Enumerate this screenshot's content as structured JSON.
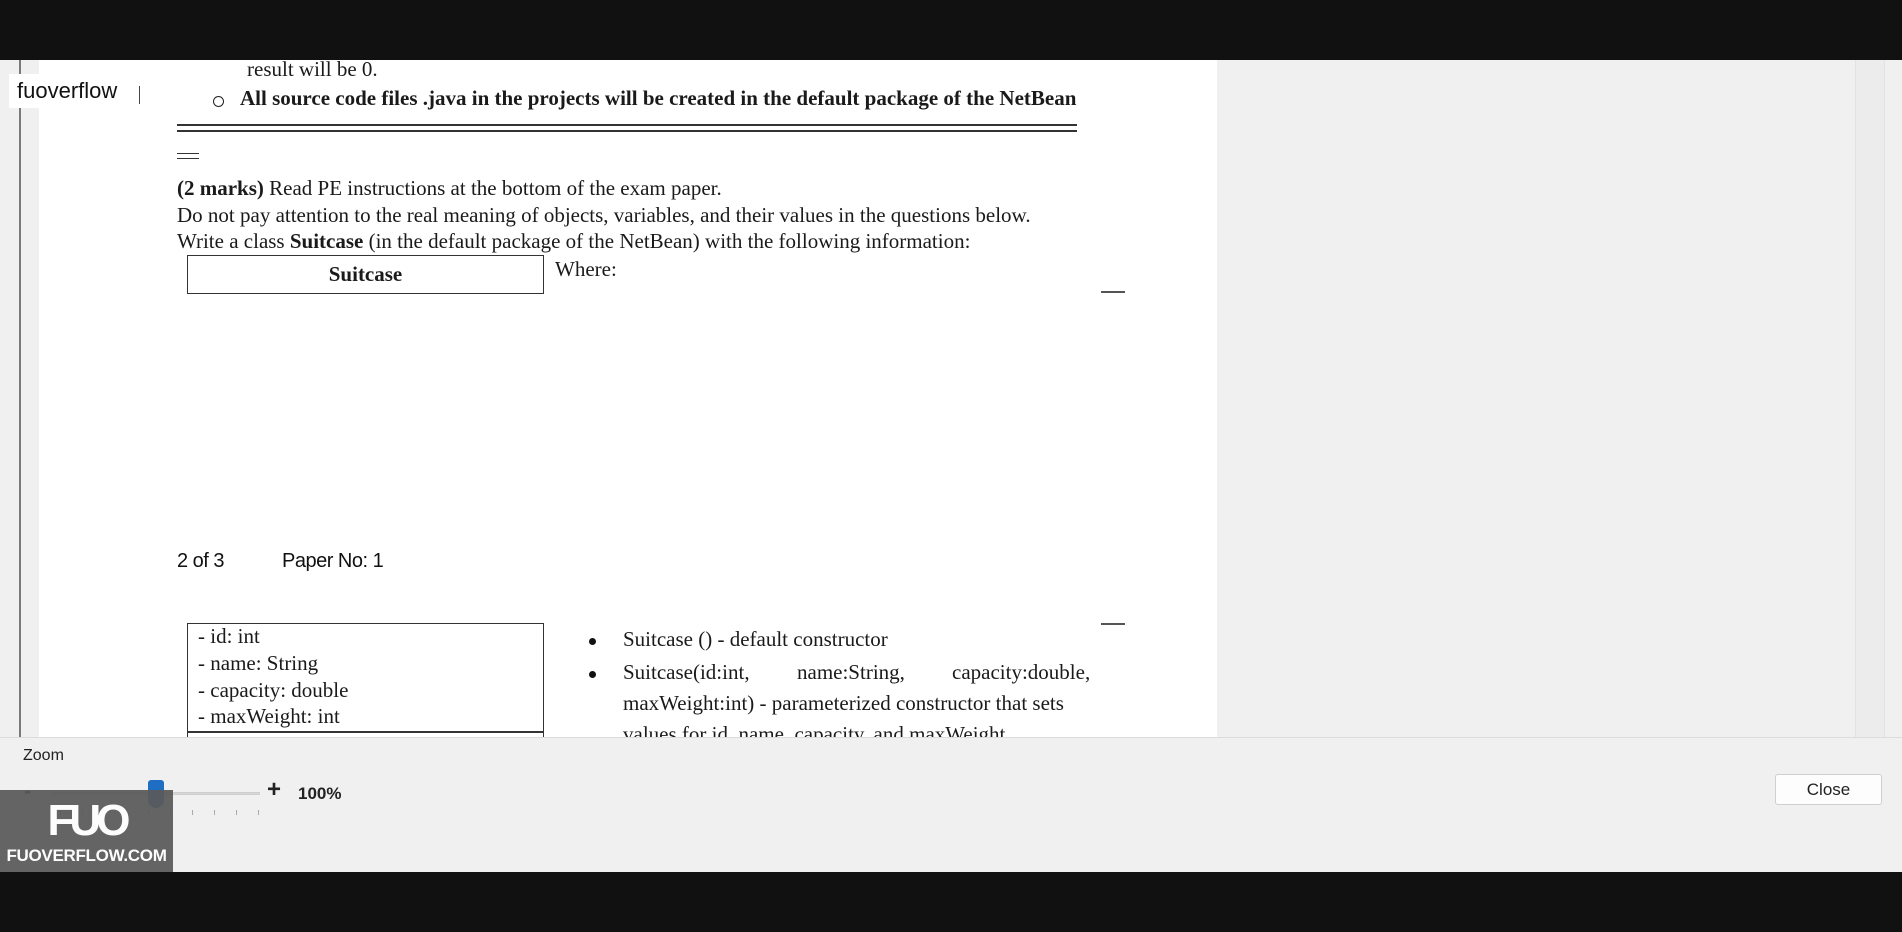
{
  "watermark": {
    "label": "fuoverflow"
  },
  "document": {
    "lines": {
      "result_line": "result will be 0.",
      "source_files_note": "All source code files .java in the projects will be created in the default package of the NetBean",
      "marks_bold": "(2 marks)",
      "marks_rest": " Read PE instructions at the bottom of the exam paper.",
      "attention_note": "Do not pay attention to the real meaning of objects, variables, and their values in the questions below.",
      "write_class_pre": "Write a class ",
      "write_class_name": "Suitcase",
      "write_class_post": " (in the default package of the NetBean) with the following information:",
      "where_label": "Where:"
    },
    "uml": {
      "class_name": "Suitcase",
      "attributes": [
        "- id: int",
        "- name: String",
        "- capacity: double",
        "- maxWeight: int"
      ]
    },
    "bullets": {
      "default_constructor": "Suitcase () - default constructor",
      "param_ctor_line1": [
        "Suitcase(id:int,",
        "name:String,",
        "capacity:double,"
      ],
      "param_ctor_line2": "maxWeight:int) - parameterized constructor that sets",
      "param_ctor_line3": "values for id, name, capacity, and maxWeight"
    },
    "footer": {
      "page": "2 of 3",
      "paper": "Paper No: 1"
    }
  },
  "zoom": {
    "label": "Zoom",
    "minus": "-",
    "plus": "+",
    "value_label": "100%",
    "level_percent": 100
  },
  "buttons": {
    "close": "Close"
  },
  "logo": {
    "mark": "FUO",
    "text": "FUOVERFLOW.COM"
  },
  "colors": {
    "slider_thumb": "#1e6fc4",
    "window_bg": "#f0f0f0",
    "letterbox": "#111111"
  }
}
